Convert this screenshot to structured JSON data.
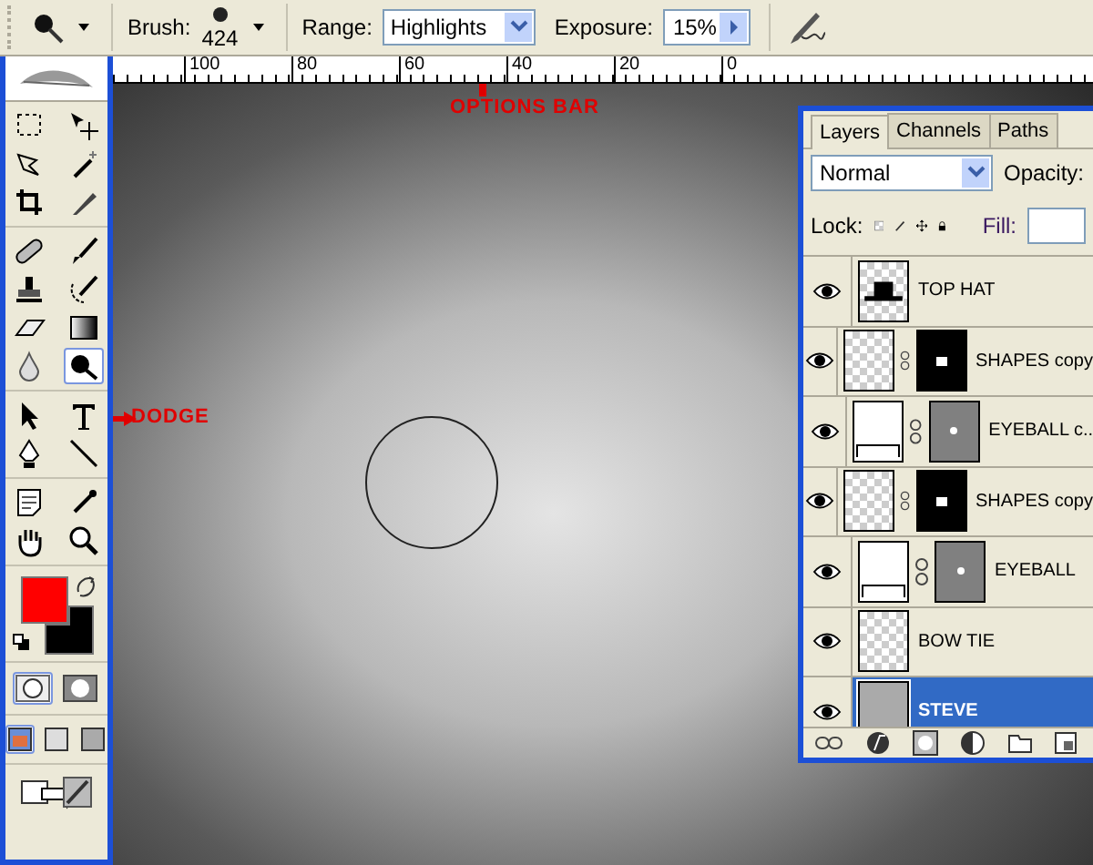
{
  "options_bar": {
    "brush_label": "Brush:",
    "brush_size": "424",
    "range_label": "Range:",
    "range_value": "Highlights",
    "exposure_label": "Exposure:",
    "exposure_value": "15%"
  },
  "ruler": [
    "100",
    "80",
    "60",
    "40",
    "20",
    "0"
  ],
  "toolbox": {
    "groups": [
      [
        {
          "kind": "marquee",
          "selected": false
        },
        {
          "kind": "move",
          "selected": false
        },
        {
          "kind": "lasso",
          "selected": false
        },
        {
          "kind": "wand",
          "selected": false
        },
        {
          "kind": "crop",
          "selected": false
        },
        {
          "kind": "slice",
          "selected": false
        }
      ],
      [
        {
          "kind": "heal",
          "selected": false
        },
        {
          "kind": "brush",
          "selected": false
        },
        {
          "kind": "stamp",
          "selected": false
        },
        {
          "kind": "history",
          "selected": false
        },
        {
          "kind": "eraser",
          "selected": false
        },
        {
          "kind": "gradient",
          "selected": false
        },
        {
          "kind": "blur",
          "selected": false
        },
        {
          "kind": "dodge",
          "selected": true
        }
      ],
      [
        {
          "kind": "path",
          "selected": false
        },
        {
          "kind": "type",
          "selected": false
        },
        {
          "kind": "pen",
          "selected": false
        },
        {
          "kind": "line",
          "selected": false
        }
      ],
      [
        {
          "kind": "notes",
          "selected": false
        },
        {
          "kind": "eyedropper",
          "selected": false
        },
        {
          "kind": "hand",
          "selected": false
        },
        {
          "kind": "zoom",
          "selected": false
        }
      ]
    ],
    "swatches": [
      {
        "color": "#ff0000"
      },
      {
        "color": "#000000"
      }
    ],
    "mask_modes": [
      {
        "selected": true
      },
      {
        "selected": false
      }
    ],
    "screen_modes": [
      {
        "selected": true
      },
      {
        "selected": false
      },
      {
        "selected": false
      }
    ]
  },
  "annotations": [
    {
      "text": "OPTIONS BAR"
    },
    {
      "text": "DODGE"
    }
  ],
  "layers_panel": {
    "tabs": [
      {
        "label": "Layers",
        "selected": true
      },
      {
        "label": "Channels",
        "selected": false
      },
      {
        "label": "Paths",
        "selected": false
      }
    ],
    "blend_mode": "Normal",
    "opacity_label": "Opacity:",
    "lock_label": "Lock:",
    "fill_label": "Fill:",
    "layers": [
      {
        "name": "TOP HAT",
        "kind": "hat",
        "visible": true,
        "selected": false
      },
      {
        "name": "SHAPES copy",
        "kind": "shape",
        "visible": true,
        "selected": false
      },
      {
        "name": "EYEBALL c..",
        "kind": "fill",
        "visible": true,
        "selected": false
      },
      {
        "name": "SHAPES copy",
        "kind": "shape",
        "visible": true,
        "selected": false
      },
      {
        "name": "EYEBALL",
        "kind": "fill",
        "visible": true,
        "selected": false
      },
      {
        "name": "BOW TIE",
        "kind": "empty",
        "visible": true,
        "selected": false
      },
      {
        "name": "STEVE",
        "kind": "photo",
        "visible": true,
        "selected": true
      }
    ]
  }
}
